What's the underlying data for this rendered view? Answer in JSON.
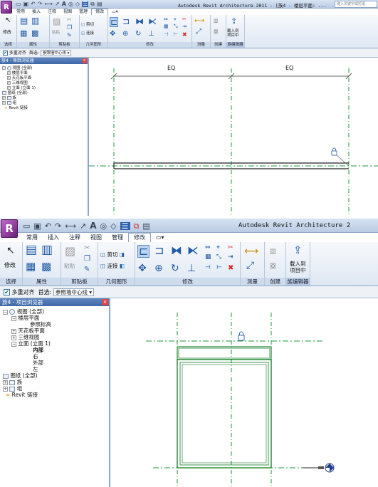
{
  "app": {
    "logo_letter": "R",
    "title_short": "Autodesk Revit Architecture 2011 - [族4 - 楼层平面: ...",
    "title_long": "Autodesk Revit Architecture 2",
    "search_placeholder": "键入关键字或短语"
  },
  "tabs": [
    "常用",
    "插入",
    "注释",
    "视图",
    "管理",
    "修改"
  ],
  "active_tab": "修改",
  "ribbon": {
    "modify_label": "修改",
    "clipboard": {
      "paste": "粘贴",
      "cut": "剪切",
      "join": "连接"
    },
    "panels": [
      "选择",
      "属性",
      "剪贴板",
      "几何图形",
      "修改",
      "测量",
      "创建",
      "族编辑器"
    ],
    "load_into_project": "载入到\n项目中"
  },
  "options": {
    "multi_align_label": "多重对齐",
    "prefer_label": "首选:",
    "prefer_value": "参照墙中心线"
  },
  "browser": {
    "header": "族4 - 项目浏览器",
    "top_tree": [
      "视图 (全部)",
      "楼层平面",
      "天花板平面",
      "三维视图",
      "立面 (立面 1)",
      "图纸 (全部)",
      "族",
      "组",
      "Revit 链接"
    ],
    "bottom_tree": [
      "视图 (全部)",
      "楼层平面",
      "参照标高",
      "天花板平面",
      "三维视图",
      "立面 (立面 1)",
      "内部",
      "右",
      "外部",
      "左",
      "图纸 (全部)",
      "族",
      "组",
      "Revit 链接"
    ]
  },
  "drawing": {
    "dim_left": "EQ",
    "dim_right": "EQ"
  },
  "colors": {
    "ribbon_bg": "#dfe8f3",
    "title_bg": "#c8d8ec",
    "browser_head": "#4a72b0",
    "ref_plane": "#1a9a3a",
    "wall_line": "#0b7a1e"
  }
}
